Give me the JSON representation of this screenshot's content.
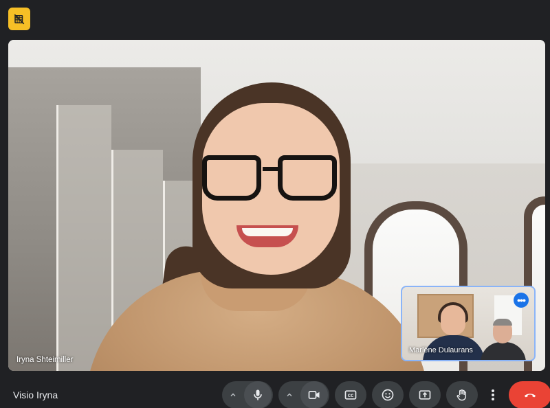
{
  "app": {
    "status_badge_icon": "camera-off-icon",
    "accent_color": "#f6bf26"
  },
  "main_video": {
    "participant_name": "Iryna Shteimiller"
  },
  "pip_video": {
    "participant_name": "Marlène Dulaurans",
    "more_options_icon": "more-horizontal-icon",
    "border_color": "#8ab4f8"
  },
  "toolbar": {
    "meeting_title": "Visio Iryna",
    "buttons": [
      {
        "name": "audio-options",
        "icon": "chevron-up-icon"
      },
      {
        "name": "microphone",
        "icon": "mic-icon"
      },
      {
        "name": "video-options",
        "icon": "chevron-up-icon"
      },
      {
        "name": "camera",
        "icon": "videocam-icon"
      },
      {
        "name": "captions",
        "icon": "closed-caption-icon"
      },
      {
        "name": "reactions",
        "icon": "emoji-icon"
      },
      {
        "name": "present",
        "icon": "present-screen-icon"
      },
      {
        "name": "raise-hand",
        "icon": "hand-icon"
      },
      {
        "name": "more-options",
        "icon": "more-vertical-icon"
      },
      {
        "name": "leave-call",
        "icon": "call-end-icon"
      }
    ],
    "end_call_color": "#ea4335"
  }
}
